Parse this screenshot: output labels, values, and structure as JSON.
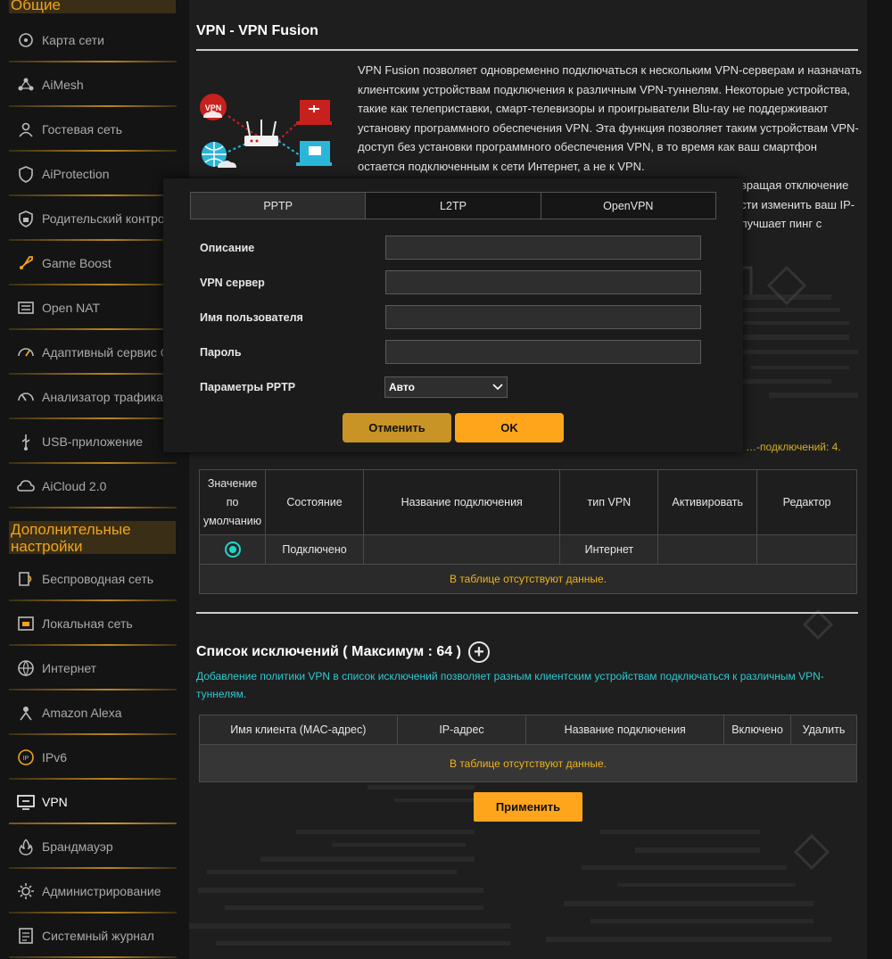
{
  "sidebar": {
    "general_header": "Общие",
    "advanced_header": "Дополнительные настройки",
    "general_items": [
      {
        "label": "Карта сети",
        "icon": "network-map-icon"
      },
      {
        "label": "AiMesh",
        "icon": "aimesh-icon"
      },
      {
        "label": "Гостевая сеть",
        "icon": "guest-network-icon"
      },
      {
        "label": "AiProtection",
        "icon": "aiprotection-icon"
      },
      {
        "label": "Родительский контроль",
        "icon": "parental-control-icon"
      },
      {
        "label": "Game Boost",
        "icon": "game-boost-icon"
      },
      {
        "label": "Open NAT",
        "icon": "open-nat-icon"
      },
      {
        "label": "Адаптивный сервис QoS",
        "icon": "qos-icon"
      },
      {
        "label": "Анализатор трафика",
        "icon": "traffic-analyzer-icon"
      },
      {
        "label": "USB-приложение",
        "icon": "usb-app-icon"
      },
      {
        "label": "AiCloud 2.0",
        "icon": "aicloud-icon"
      }
    ],
    "advanced_items": [
      {
        "label": "Беспроводная сеть",
        "icon": "wireless-icon"
      },
      {
        "label": "Локальная сеть",
        "icon": "lan-icon"
      },
      {
        "label": "Интернет",
        "icon": "internet-icon"
      },
      {
        "label": "Amazon Alexa",
        "icon": "alexa-icon"
      },
      {
        "label": "IPv6",
        "icon": "ipv6-icon"
      },
      {
        "label": "VPN",
        "icon": "vpn-icon"
      },
      {
        "label": "Брандмауэр",
        "icon": "firewall-icon"
      },
      {
        "label": "Администрирование",
        "icon": "administration-icon"
      },
      {
        "label": "Системный журнал",
        "icon": "system-log-icon"
      }
    ]
  },
  "page": {
    "title": "VPN - VPN Fusion",
    "intro_p1": "VPN Fusion позволяет одновременно подключаться к нескольким VPN-серверам и назначать клиентским устройствам подключения к различным VPN-туннелям. Некоторые устройства, такие как телеприставки, смарт-телевизоры и проигрыватели Blu-ray не поддерживают установку программного обеспечения VPN. Эта функция позволяет таким устройствам VPN-доступ без установки программного обеспечения VPN, в то время как ваш смартфон остается подключенным к сети Интернет, а не к VPN.",
    "intro_p2": "вращая отключение сти изменить ваш IP- лучшает пинг с",
    "hint": "…-подключений: 4.",
    "vpn_badge": "VPN",
    "accent": "#ffa51c",
    "teal": "#2ec9d4"
  },
  "server_table": {
    "headers": [
      "Значение по умолчанию",
      "Состояние",
      "Название подключения",
      "тип VPN",
      "Активировать",
      "Редактор"
    ],
    "row": {
      "status": "Подключено",
      "name": "",
      "type": "Интернет"
    },
    "no_data": "В таблице отсутствуют данные."
  },
  "exception": {
    "title": "Список исключений ( Максимум : 64 )",
    "desc": "Добавление политики VPN в список исключений позволяет разным клиентским устройствам подключаться к различным VPN-туннелям.",
    "headers": [
      "Имя клиента (MAC-адрес)",
      "IP-адрес",
      "Название подключения",
      "Включено",
      "Удалить"
    ],
    "no_data": "В таблице отсутствуют данные.",
    "apply": "Применить"
  },
  "modal": {
    "tabs": [
      "PPTP",
      "L2TP",
      "OpenVPN"
    ],
    "fields": {
      "description": {
        "label": "Описание",
        "value": ""
      },
      "server": {
        "label": "VPN сервер",
        "value": ""
      },
      "username": {
        "label": "Имя пользователя",
        "value": ""
      },
      "password": {
        "label": "Пароль",
        "value": ""
      },
      "pptp_options": {
        "label": "Параметры PPTP",
        "value": "Авто"
      }
    },
    "cancel": "Отменить",
    "ok": "OK"
  }
}
